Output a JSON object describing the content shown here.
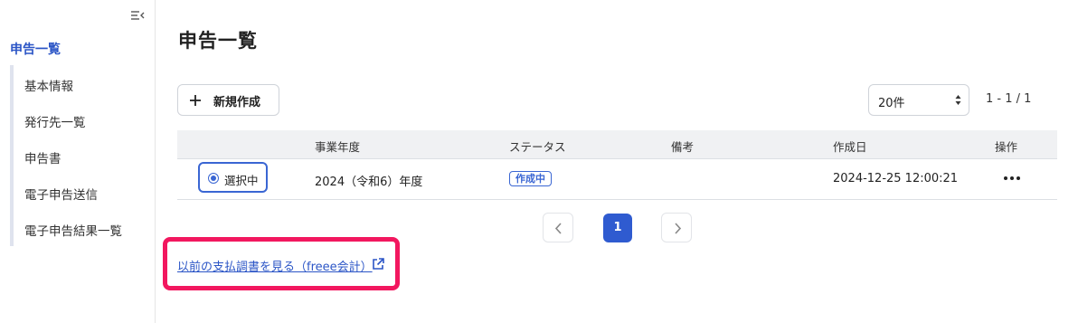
{
  "sidebar": {
    "title": "申告一覧",
    "items": [
      {
        "label": "基本情報"
      },
      {
        "label": "発行先一覧"
      },
      {
        "label": "申告書"
      },
      {
        "label": "電子申告送信"
      },
      {
        "label": "電子申告結果一覧"
      }
    ],
    "collapse_icon": "sidebar-collapse-icon"
  },
  "main": {
    "title": "申告一覧",
    "new_button_label": "新規作成",
    "per_page_value": "20件",
    "range_text": "1 - 1 / 1",
    "table": {
      "columns": [
        "事業年度",
        "ステータス",
        "備考",
        "作成日",
        "操作"
      ],
      "rows": [
        {
          "selection_label": "選択中",
          "fiscal_year": "2024（令和6）年度",
          "status": "作成中",
          "note": "",
          "created_at": "2024-12-25 12:00:21"
        }
      ]
    },
    "pagination": {
      "current_page": "1"
    },
    "previous_docs_link": "以前の支払調書を見る（freee会計）"
  },
  "colors": {
    "accent": "#2f5bd0",
    "highlight": "#f2175f"
  }
}
